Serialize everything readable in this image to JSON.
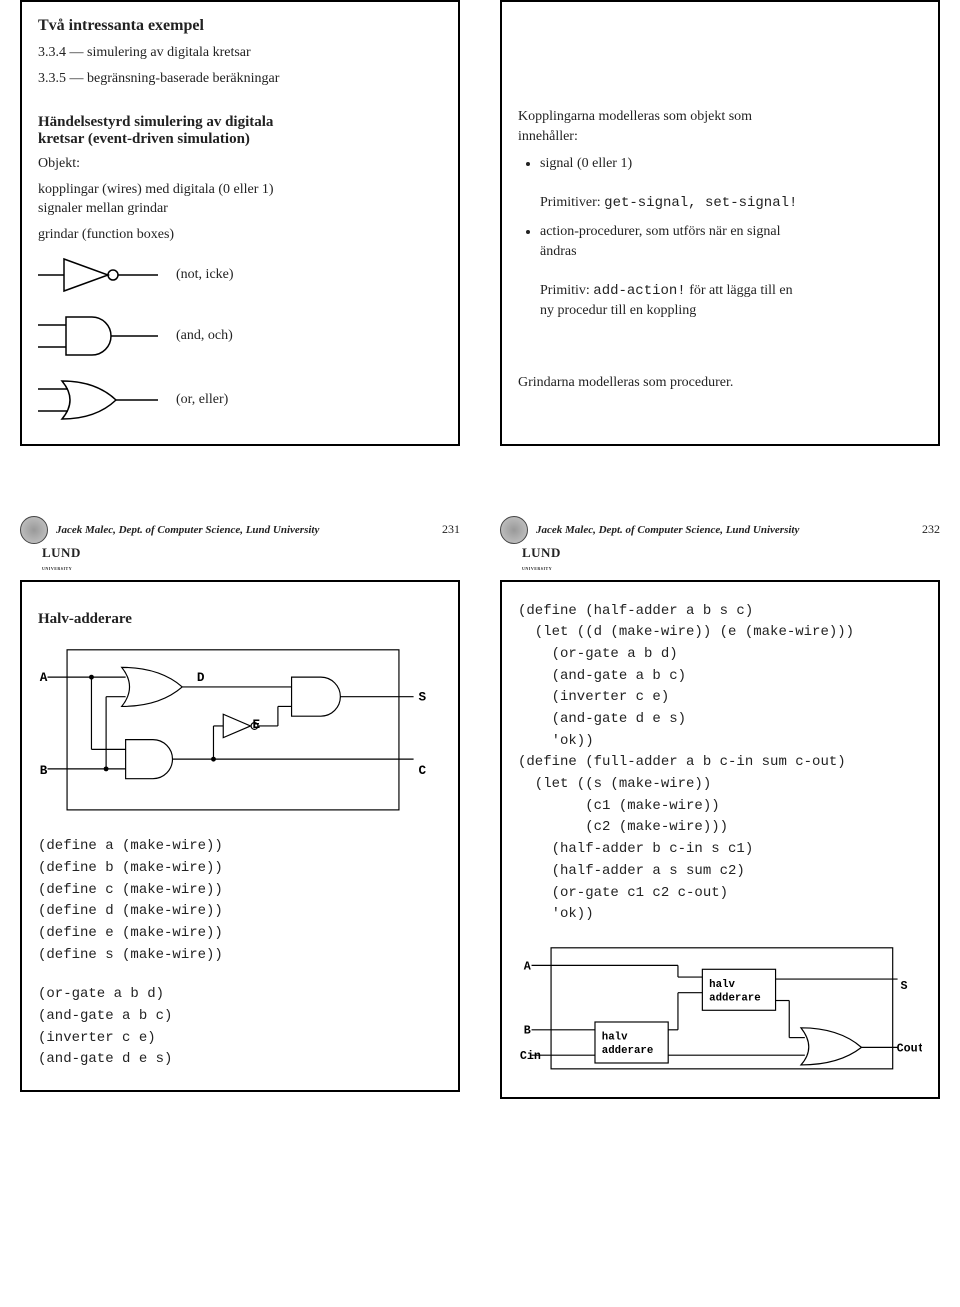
{
  "slide231": {
    "intro_heading": "Två intressanta exempel",
    "item1": "3.3.4 — simulering av digitala kretsar",
    "item2": "3.3.5 — begränsning-baserade beräkningar",
    "section_heading1": "Händelsestyrd simulering av digitala",
    "section_heading2": "kretsar (event-driven simulation)",
    "objekt": "Objekt:",
    "wires1": "kopplingar (wires) med digitala (0 eller 1)",
    "wires2": "signaler mellan grindar",
    "gates_line": "grindar (function boxes)",
    "not_label": "(not, icke)",
    "and_label": "(and, och)",
    "or_label": "(or, eller)"
  },
  "slide232": {
    "intro1": "Kopplingarna modelleras som objekt som",
    "intro2": "innehåller:",
    "bullet1": "signal (0 eller 1)",
    "bullet1_line2a": "Primitiver: ",
    "bullet1_line2b": "get-signal, set-signal!",
    "bullet2a": "action-procedurer, som utförs när en signal",
    "bullet2b": "ändras",
    "bullet2_line2a": "Primitiv: ",
    "bullet2_line2b": "add-action!",
    "bullet2_line2c": " för att lägga till en",
    "bullet2_line2d": "ny procedur till en koppling",
    "grindar": "Grindarna modelleras som procedurer."
  },
  "slide233": {
    "heading": "Halv-adderare",
    "labels": {
      "A": "A",
      "B": "B",
      "C": "C",
      "D": "D",
      "E": "E",
      "S": "S"
    },
    "code1": "(define a (make-wire))\n(define b (make-wire))\n(define c (make-wire))\n(define d (make-wire))\n(define e (make-wire))\n(define s (make-wire))",
    "code2": "(or-gate a b d)\n(and-gate a b c)\n(inverter c e)\n(and-gate d e s)"
  },
  "slide234": {
    "code": "(define (half-adder a b s c)\n  (let ((d (make-wire)) (e (make-wire)))\n    (or-gate a b d)\n    (and-gate a b c)\n    (inverter c e)\n    (and-gate d e s)\n    'ok))\n(define (full-adder a b c-in sum c-out)\n  (let ((s (make-wire))\n        (c1 (make-wire))\n        (c2 (make-wire)))\n    (half-adder b c-in s c1)\n    (half-adder a s sum c2)\n    (or-gate c1 c2 c-out)\n    'ok))",
    "labels": {
      "A": "A",
      "B": "B",
      "Cin": "Cin",
      "S": "S",
      "Cout": "Cout",
      "halv": "halv",
      "adderare": "adderare"
    }
  },
  "footer": {
    "affil": "Jacek Malec, Dept. of Computer Science, Lund University",
    "lund": "Lund",
    "univ": "university",
    "p231": "231",
    "p232": "232"
  }
}
